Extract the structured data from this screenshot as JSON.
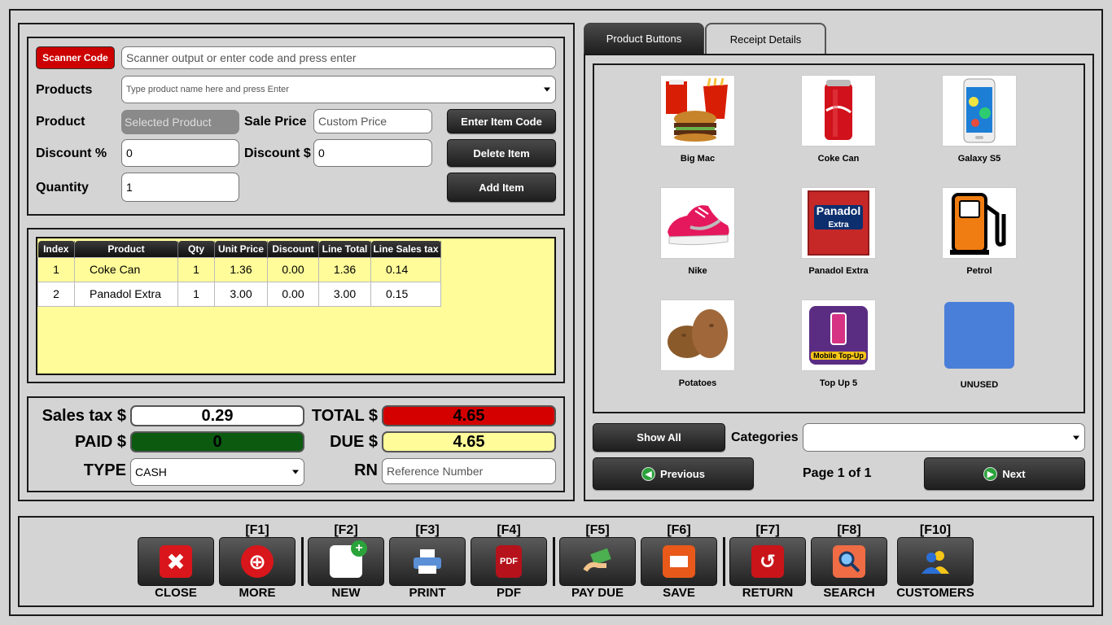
{
  "entry": {
    "scanner_btn": "Scanner Code",
    "scanner_placeholder": "Scanner output or enter code and press enter",
    "products_label": "Products",
    "products_placeholder": "Type product name here and press Enter",
    "product_label": "Product",
    "product_value": "Selected Product",
    "sale_price_label": "Sale Price",
    "sale_price_placeholder": "Custom Price",
    "enter_code_btn": "Enter Item Code",
    "discount_pct_label": "Discount %",
    "discount_pct_value": "0",
    "discount_amt_label": "Discount $",
    "discount_amt_value": "0",
    "delete_btn": "Delete Item",
    "quantity_label": "Quantity",
    "quantity_value": "1",
    "add_btn": "Add Item"
  },
  "grid": {
    "headers": [
      "Index",
      "Product",
      "Qty",
      "Unit Price",
      "Discount",
      "Line Total",
      "Line Sales tax"
    ],
    "rows": [
      [
        "1",
        "Coke Can",
        "1",
        "1.36",
        "0.00",
        "1.36",
        "0.14"
      ],
      [
        "2",
        "Panadol Extra",
        "1",
        "3.00",
        "0.00",
        "3.00",
        "0.15"
      ]
    ]
  },
  "totals": {
    "sales_tax_label": "Sales tax $",
    "sales_tax_value": "0.29",
    "total_label": "TOTAL $",
    "total_value": "4.65",
    "paid_label": "PAID $",
    "paid_value": "0",
    "due_label": "DUE $",
    "due_value": "4.65",
    "type_label": "TYPE",
    "type_value": "CASH",
    "rn_label": "RN",
    "rn_placeholder": "Reference Number"
  },
  "tabs": [
    "Product Buttons",
    "Receipt Details"
  ],
  "products": [
    "Big Mac",
    "Coke Can",
    "Galaxy S5",
    "Nike",
    "Panadol Extra",
    "Petrol",
    "Potatoes",
    "Top Up 5",
    "UNUSED"
  ],
  "product_overlay_text": {
    "panadol": "Panadol",
    "panadol_sub": "Extra",
    "topup": "Mobile Top-Up"
  },
  "nav": {
    "show_all": "Show All",
    "categories_label": "Categories",
    "previous": "Previous",
    "page": "Page 1 of 1",
    "next": "Next"
  },
  "toolbar": {
    "close": {
      "key": "",
      "label": "CLOSE"
    },
    "more": {
      "key": "[F1]",
      "label": "MORE"
    },
    "new": {
      "key": "[F2]",
      "label": "NEW"
    },
    "print": {
      "key": "[F3]",
      "label": "PRINT"
    },
    "pdf": {
      "key": "[F4]",
      "label": "PDF",
      "icon_text": "PDF"
    },
    "pay_due": {
      "key": "[F5]",
      "label": "PAY DUE"
    },
    "save": {
      "key": "[F6]",
      "label": "SAVE"
    },
    "return": {
      "key": "[F7]",
      "label": "RETURN"
    },
    "search": {
      "key": "[F8]",
      "label": "SEARCH"
    },
    "customers": {
      "key": "[F10]",
      "label": "CUSTOMERS"
    }
  },
  "colors": {
    "total_bg": "#d40000",
    "paid_bg": "#0b5a10",
    "due_bg": "#fffc99",
    "scanner_btn_bg": "#cc0000",
    "unused_tile": "#4a7fd9"
  }
}
